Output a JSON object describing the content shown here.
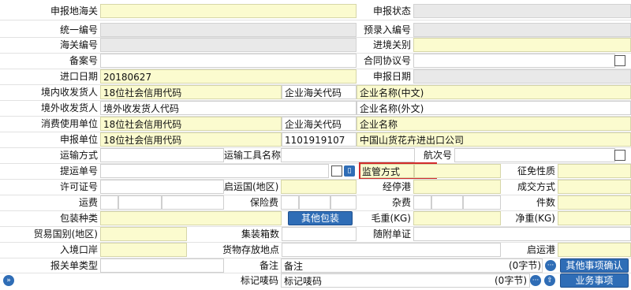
{
  "labels": {
    "declare_port": "申报地海关",
    "declare_status": "申报状态",
    "unified_no": "统一编号",
    "pre_entry_no": "预录入编号",
    "customs_no": "海关编号",
    "entry_port": "进境关别",
    "record_no": "备案号",
    "contract_no": "合同协议号",
    "import_date": "进口日期",
    "declare_date": "申报日期",
    "domestic_consignee": "境内收发货人",
    "enterprise_customs_code": "企业海关代码",
    "overseas_consignee": "境外收发货人",
    "consumer_unit": "消费使用单位",
    "declare_unit": "申报单位",
    "transport_mode": "运输方式",
    "transport_name": "运输工具名称",
    "voyage_no": "航次号",
    "bill_no": "提运单号",
    "supervision": "监管方式",
    "tax_nature": "征免性质",
    "license_no": "许可证号",
    "departure_country": "启运国(地区)",
    "stop_port": "经停港",
    "deal_mode": "成交方式",
    "freight": "运费",
    "insurance": "保险费",
    "misc_fee": "杂费",
    "pieces": "件数",
    "pack_type": "包装种类",
    "gross_weight": "毛重(KG)",
    "net_weight": "净重(KG)",
    "trade_country": "贸易国别(地区)",
    "container_count": "集装箱数",
    "attached_docs": "随附单证",
    "entry_port2": "入境口岸",
    "goods_location": "货物存放地点",
    "departure_port": "启运港",
    "declaration_type": "报关单类型",
    "remark": "备注",
    "mark_code": "标记唛码"
  },
  "values": {
    "import_date": "20180627",
    "domestic_consignee_credit": "18位社会信用代码",
    "domestic_company_name": "企业名称(中文)",
    "overseas_code": "境外收发货人代码",
    "overseas_company_name": "企业名称(外文)",
    "consumer_credit": "18位社会信用代码",
    "consumer_customs_code_label": "企业海关代码",
    "consumer_company_name": "企业名称",
    "declare_credit": "18位社会信用代码",
    "declare_customs_code": "1101919107",
    "declare_company_name": "中国山货花卉进出口公司",
    "remark_placeholder": "备注",
    "mark_placeholder": "标记唛码",
    "remark_counter": "(0字节)",
    "mark_counter": "(0字节)"
  },
  "buttons": {
    "other_packaging": "其他包装",
    "other_confirm": "其他事项确认",
    "business_matters": "业务事项"
  },
  "icons": {
    "ellipsis": "···",
    "up": "⇧",
    "expand": "»"
  },
  "colors": {
    "field_yellow": "#fbfbcf",
    "field_gray": "#e9e9e9",
    "button_blue": "#2f6db6",
    "highlight_red": "#d22c2c"
  }
}
